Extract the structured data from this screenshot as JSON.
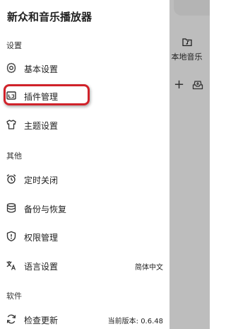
{
  "app": {
    "title": "新众和音乐播放器"
  },
  "background": {
    "local_music_label": "本地音乐"
  },
  "sections": [
    {
      "label": "设置",
      "items": [
        {
          "label": "基本设置",
          "icon": "gear-icon"
        },
        {
          "label": "插件管理",
          "icon": "plugin-icon",
          "highlighted": true
        },
        {
          "label": "主题设置",
          "icon": "shirt-icon"
        }
      ]
    },
    {
      "label": "其他",
      "items": [
        {
          "label": "定时关闭",
          "icon": "alarm-icon"
        },
        {
          "label": "备份与恢复",
          "icon": "database-icon"
        },
        {
          "label": "权限管理",
          "icon": "shield-icon"
        },
        {
          "label": "语言设置",
          "icon": "translate-icon",
          "value": "简体中文"
        }
      ]
    },
    {
      "label": "软件",
      "items": [
        {
          "label": "检查更新",
          "icon": "refresh-icon",
          "value": "当前版本: 0.6.48"
        }
      ]
    }
  ],
  "colors": {
    "highlight_border": "#d0222a",
    "overlay": "#bdbdbd"
  }
}
